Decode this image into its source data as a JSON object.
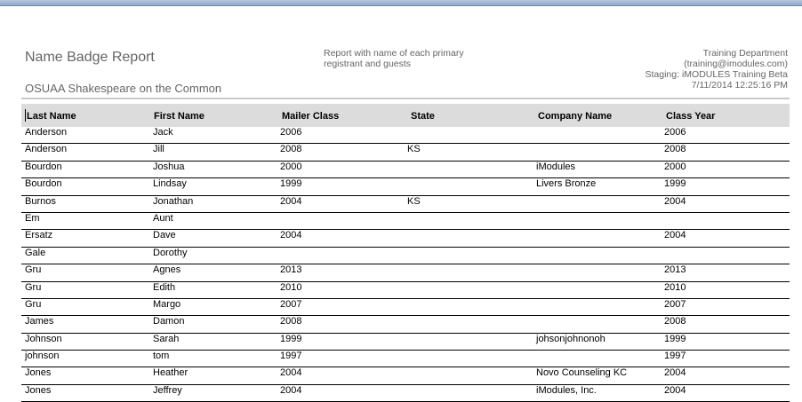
{
  "report": {
    "title": "Name Badge Report",
    "subtitle": "OSUAA Shakespeare on the Common",
    "description": "Report with name of each primary registrant and guests",
    "info": {
      "department": "Training Department",
      "email": "(training@imodules.com)",
      "staging": "Staging: iMODULES Training Beta",
      "timestamp": "7/11/2014 12:25:16 PM"
    }
  },
  "table": {
    "columns": [
      "Last Name",
      "First Name",
      "Mailer Class",
      "State",
      "Company Name",
      "Class Year"
    ],
    "rows": [
      [
        "Anderson",
        "Jack",
        "2006",
        "",
        "",
        "2006"
      ],
      [
        "Anderson",
        "Jill",
        "2008",
        "KS",
        "",
        "2008"
      ],
      [
        "Bourdon",
        "Joshua",
        "2000",
        "",
        "iModules",
        "2000"
      ],
      [
        "Bourdon",
        "Lindsay",
        "1999",
        "",
        "Livers Bronze",
        "1999"
      ],
      [
        "Burnos",
        "Jonathan",
        "2004",
        "KS",
        "",
        "2004"
      ],
      [
        "Em",
        "Aunt",
        "",
        "",
        "",
        ""
      ],
      [
        "Ersatz",
        "Dave",
        "2004",
        "",
        "",
        "2004"
      ],
      [
        "Gale",
        "Dorothy",
        "",
        "",
        "",
        ""
      ],
      [
        "Gru",
        "Agnes",
        "2013",
        "",
        "",
        "2013"
      ],
      [
        "Gru",
        "Edith",
        "2010",
        "",
        "",
        "2010"
      ],
      [
        "Gru",
        "Margo",
        "2007",
        "",
        "",
        "2007"
      ],
      [
        "James",
        "Damon",
        "2008",
        "",
        "",
        "2008"
      ],
      [
        "Johnson",
        "Sarah",
        "1999",
        "",
        "johsonjohnonoh",
        "1999"
      ],
      [
        "johnson",
        "tom",
        "1997",
        "",
        "",
        "1997"
      ],
      [
        "Jones",
        "Heather",
        "2004",
        "",
        "Novo Counseling KC",
        "2004"
      ],
      [
        "Jones",
        "Jeffrey",
        "2004",
        "",
        "iModules, Inc.",
        "2004"
      ]
    ]
  }
}
